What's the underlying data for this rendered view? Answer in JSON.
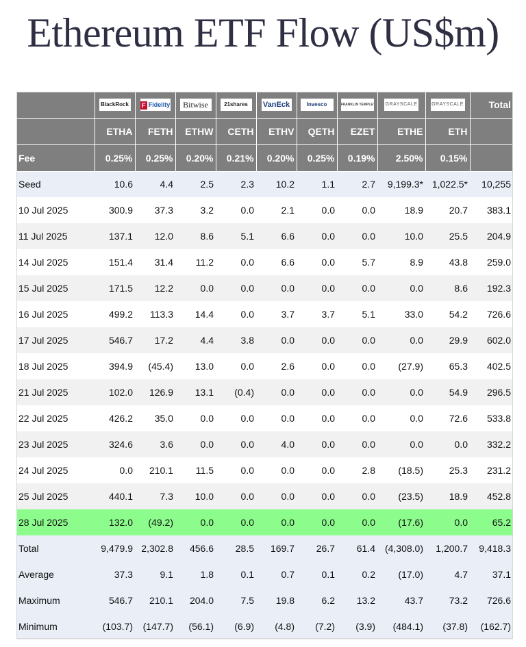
{
  "title": "Ethereum ETF Flow (US$m)",
  "issuers": [
    {
      "name": "BlackRock",
      "icon": "blackrock-logo"
    },
    {
      "name": "Fidelity",
      "icon": "fidelity-logo"
    },
    {
      "name": "Bitwise",
      "icon": "bitwise-logo"
    },
    {
      "name": "21shares",
      "icon": "21shares-logo"
    },
    {
      "name": "VanEck",
      "icon": "vaneck-logo"
    },
    {
      "name": "Invesco",
      "icon": "invesco-logo"
    },
    {
      "name": "FRANKLIN TEMPLETON",
      "icon": "franklin-templeton-logo"
    },
    {
      "name": "GRAYSCALE",
      "icon": "grayscale-logo"
    },
    {
      "name": "GRAYSCALE",
      "icon": "grayscale-logo"
    }
  ],
  "total_header": "Total",
  "tickers": [
    "ETHA",
    "FETH",
    "ETHW",
    "CETH",
    "ETHV",
    "QETH",
    "EZET",
    "ETHE",
    "ETH"
  ],
  "fee_label": "Fee",
  "fees": [
    "0.25%",
    "0.25%",
    "0.20%",
    "0.21%",
    "0.20%",
    "0.25%",
    "0.19%",
    "2.50%",
    "0.15%"
  ],
  "rows": [
    {
      "label": "Seed",
      "values": [
        "10.6",
        "4.4",
        "2.5",
        "2.3",
        "10.2",
        "1.1",
        "2.7",
        "9,199.3*",
        "1,022.5*",
        "10,255"
      ],
      "style": "seed"
    },
    {
      "label": "10 Jul 2025",
      "values": [
        "300.9",
        "37.3",
        "3.2",
        "0.0",
        "2.1",
        "0.0",
        "0.0",
        "18.9",
        "20.7",
        "383.1"
      ],
      "style": "even"
    },
    {
      "label": "11 Jul 2025",
      "values": [
        "137.1",
        "12.0",
        "8.6",
        "5.1",
        "6.6",
        "0.0",
        "0.0",
        "10.0",
        "25.5",
        "204.9"
      ],
      "style": "odd"
    },
    {
      "label": "14 Jul 2025",
      "values": [
        "151.4",
        "31.4",
        "11.2",
        "0.0",
        "6.6",
        "0.0",
        "5.7",
        "8.9",
        "43.8",
        "259.0"
      ],
      "style": "even"
    },
    {
      "label": "15 Jul 2025",
      "values": [
        "171.5",
        "12.2",
        "0.0",
        "0.0",
        "0.0",
        "0.0",
        "0.0",
        "0.0",
        "8.6",
        "192.3"
      ],
      "style": "odd"
    },
    {
      "label": "16 Jul 2025",
      "values": [
        "499.2",
        "113.3",
        "14.4",
        "0.0",
        "3.7",
        "3.7",
        "5.1",
        "33.0",
        "54.2",
        "726.6"
      ],
      "style": "even"
    },
    {
      "label": "17 Jul 2025",
      "values": [
        "546.7",
        "17.2",
        "4.4",
        "3.8",
        "0.0",
        "0.0",
        "0.0",
        "0.0",
        "29.9",
        "602.0"
      ],
      "style": "odd"
    },
    {
      "label": "18 Jul 2025",
      "values": [
        "394.9",
        "(45.4)",
        "13.0",
        "0.0",
        "2.6",
        "0.0",
        "0.0",
        "(27.9)",
        "65.3",
        "402.5"
      ],
      "style": "even"
    },
    {
      "label": "21 Jul 2025",
      "values": [
        "102.0",
        "126.9",
        "13.1",
        "(0.4)",
        "0.0",
        "0.0",
        "0.0",
        "0.0",
        "54.9",
        "296.5"
      ],
      "style": "odd"
    },
    {
      "label": "22 Jul 2025",
      "values": [
        "426.2",
        "35.0",
        "0.0",
        "0.0",
        "0.0",
        "0.0",
        "0.0",
        "0.0",
        "72.6",
        "533.8"
      ],
      "style": "even"
    },
    {
      "label": "23 Jul 2025",
      "values": [
        "324.6",
        "3.6",
        "0.0",
        "0.0",
        "4.0",
        "0.0",
        "0.0",
        "0.0",
        "0.0",
        "332.2"
      ],
      "style": "odd"
    },
    {
      "label": "24 Jul 2025",
      "values": [
        "0.0",
        "210.1",
        "11.5",
        "0.0",
        "0.0",
        "0.0",
        "2.8",
        "(18.5)",
        "25.3",
        "231.2"
      ],
      "style": "even"
    },
    {
      "label": "25 Jul 2025",
      "values": [
        "440.1",
        "7.3",
        "10.0",
        "0.0",
        "0.0",
        "0.0",
        "0.0",
        "(23.5)",
        "18.9",
        "452.8"
      ],
      "style": "odd"
    },
    {
      "label": "28 Jul 2025",
      "values": [
        "132.0",
        "(49.2)",
        "0.0",
        "0.0",
        "0.0",
        "0.0",
        "0.0",
        "(17.6)",
        "0.0",
        "65.2"
      ],
      "style": "hl"
    },
    {
      "label": "Total",
      "values": [
        "9,479.9",
        "2,302.8",
        "456.6",
        "28.5",
        "169.7",
        "26.7",
        "61.4",
        "(4,308.0)",
        "1,200.7",
        "9,418.3"
      ],
      "style": "sum"
    },
    {
      "label": "Average",
      "values": [
        "37.3",
        "9.1",
        "1.8",
        "0.1",
        "0.7",
        "0.1",
        "0.2",
        "(17.0)",
        "4.7",
        "37.1"
      ],
      "style": "sum"
    },
    {
      "label": "Maximum",
      "values": [
        "546.7",
        "210.1",
        "204.0",
        "7.5",
        "19.8",
        "6.2",
        "13.2",
        "43.7",
        "73.2",
        "726.6"
      ],
      "style": "sum"
    },
    {
      "label": "Minimum",
      "values": [
        "(103.7)",
        "(147.7)",
        "(56.1)",
        "(6.9)",
        "(4.8)",
        "(7.2)",
        "(3.9)",
        "(484.1)",
        "(37.8)",
        "(162.7)"
      ],
      "style": "sum"
    }
  ],
  "colors": {
    "header_bg": "#7f7f7f",
    "negative": "#d62020",
    "highlight": "#8cfc8c",
    "summary_bg": "#e9eef7",
    "title": "#2f2f44"
  }
}
